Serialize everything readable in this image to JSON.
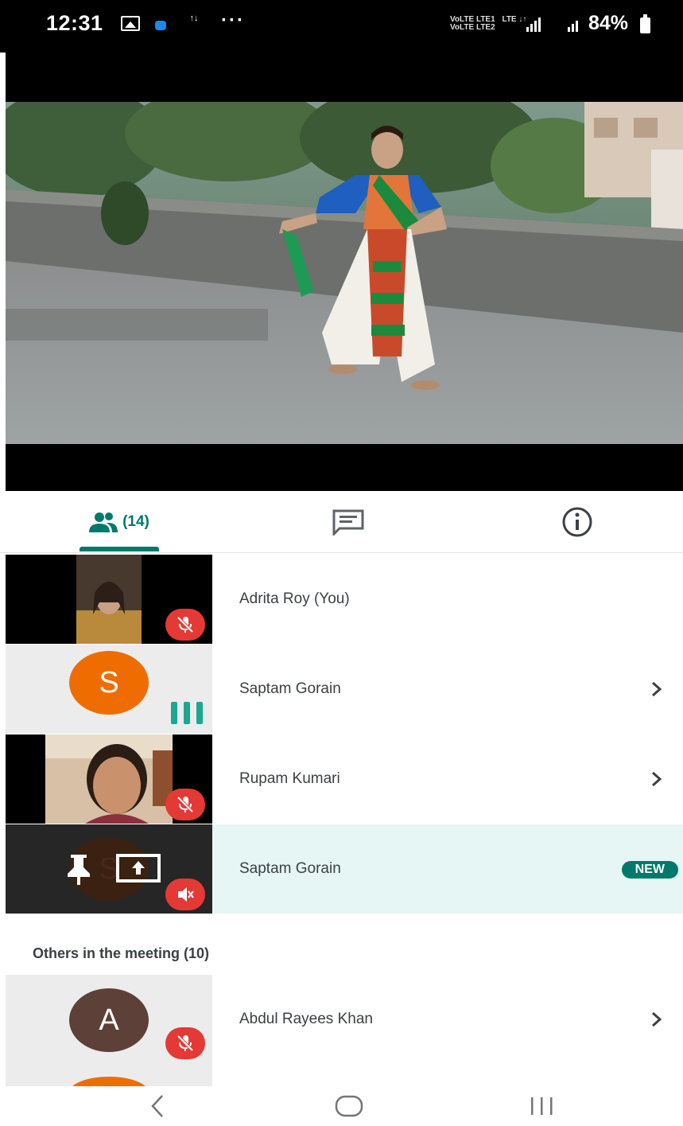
{
  "status_bar": {
    "time": "12:31",
    "data_indicator": "↑↓",
    "more_dots": "···",
    "network": [
      "VoLTE LTE1",
      "LTE ↓↑",
      "VoLTE LTE2"
    ],
    "battery": "84%"
  },
  "video": {
    "description_icon": "dance-performance-video"
  },
  "tabs": {
    "people_count": "(14)"
  },
  "participants": [
    {
      "name": "Adrita Roy (You)",
      "mic": "muted"
    },
    {
      "name": "Saptam Gorain",
      "avatar_letter": "S",
      "avatar_color": "#ef6c00",
      "mic": "speaking"
    },
    {
      "name": "Rupam Kumari",
      "mic": "muted"
    },
    {
      "name": "Saptam Gorain",
      "badge": "NEW",
      "mic": "muted",
      "avatar_letter": "S"
    }
  ],
  "others": {
    "heading": "Others in the meeting (10)",
    "items": [
      {
        "name": "Abdul Rayees Khan",
        "avatar_letter": "A",
        "avatar_color": "#5d4037"
      }
    ]
  },
  "colors": {
    "accent": "#00796b",
    "mute_red": "#e53935",
    "highlight_row": "#e6f6f5"
  }
}
